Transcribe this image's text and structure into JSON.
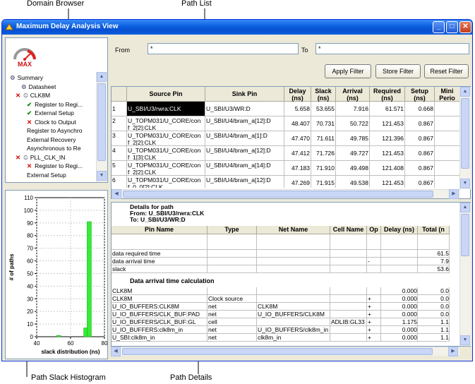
{
  "callouts": {
    "domain_browser": "Domain Browser",
    "path_list": "Path List",
    "path_slack_histogram": "Path Slack Histogram",
    "path_details": "Path Details"
  },
  "window": {
    "title": "Maximum Delay Analysis View",
    "minimize": "_",
    "maximize": "□",
    "close": "✕"
  },
  "logo": {
    "text": "MAX"
  },
  "filter": {
    "from_label": "From",
    "from_value": "*",
    "to_label": "To",
    "to_value": "*",
    "apply": "Apply Filter",
    "store": "Store Filter",
    "reset": "Reset Filter"
  },
  "tree": [
    {
      "label": "Summary",
      "icon": "summary-icon"
    },
    {
      "label": "Datasheet",
      "icon": "datasheet-icon"
    },
    {
      "label": "CLK8M",
      "icon": "clock-icon",
      "status": "✕"
    },
    {
      "label": "Register to Regi...",
      "status": "✔"
    },
    {
      "label": "External Setup",
      "status": "✔"
    },
    {
      "label": "Clock to Output",
      "status": "✕"
    },
    {
      "label": "Register to Asynchro"
    },
    {
      "label": "External Recovery"
    },
    {
      "label": "Asynchronous to Re"
    },
    {
      "label": "PLL_CLK_IN",
      "icon": "clock-icon",
      "status": "✕"
    },
    {
      "label": "Register to Regi...",
      "status": "✕"
    },
    {
      "label": "External Setup"
    }
  ],
  "chart_data": {
    "type": "bar",
    "xlabel": "slack distribution (ns)",
    "ylabel": "# of paths",
    "xlim": [
      40,
      80
    ],
    "ylim": [
      0,
      110
    ],
    "xticks": [
      40,
      60,
      80
    ],
    "yticks": [
      0,
      10,
      20,
      30,
      40,
      50,
      60,
      70,
      80,
      90,
      100,
      110
    ],
    "x": [
      53,
      69,
      71
    ],
    "values": [
      1,
      7,
      91
    ],
    "color": "#33ee33",
    "grid": true
  },
  "path_list": {
    "columns": [
      "",
      "Source Pin",
      "Sink Pin",
      "Delay\n(ns)",
      "Slack\n(ns)",
      "Arrival\n(ns)",
      "Required\n(ns)",
      "Setup\n(ns)",
      "Mini\nPerio"
    ],
    "rows": [
      [
        "1",
        "U_SBI/U3/rwra:CLK",
        "U_SBI/U3/WR:D",
        "5.658",
        "53.655",
        "7.916",
        "61.571",
        "0.668"
      ],
      [
        "2",
        "U_TOPM031/U_CORE/con\nf_2[2]:CLK",
        "U_SBI/U4/bram_a[12]:D",
        "48.407",
        "70.731",
        "50.722",
        "121.453",
        "0.867"
      ],
      [
        "3",
        "U_TOPM031/U_CORE/con\nf_2[2]:CLK",
        "U_SBI/U4/bram_a[1]:D",
        "47.470",
        "71.611",
        "49.785",
        "121.396",
        "0.867"
      ],
      [
        "4",
        "U_TOPM031/U_CORE/con\nf_1[3]:CLK",
        "U_SBI/U4/bram_a[12]:D",
        "47.412",
        "71.726",
        "49.727",
        "121.453",
        "0.867"
      ],
      [
        "5",
        "U_TOPM031/U_CORE/con\nf_2[2]:CLK",
        "U_SBI/U4/bram_a[14]:D",
        "47.183",
        "71.910",
        "49.498",
        "121.408",
        "0.867"
      ],
      [
        "6",
        "U_TOPM031/U_CORE/con\nf_0_0[2]:CLK",
        "U_SBI/U4/bram_a[12]:D",
        "47.269",
        "71.915",
        "49.538",
        "121.453",
        "0.867"
      ]
    ]
  },
  "details": {
    "line1": "Details for path",
    "line2": "From: U_SBI/U3/rwra:CLK",
    "line3": "To: U_SBI/U3/WR:D",
    "columns": [
      "Pin Name",
      "Type",
      "Net Name",
      "Cell Name",
      "Op",
      "Delay (ns)",
      "Total (n"
    ],
    "summary_rows": [
      [
        "data required time",
        "",
        "",
        "",
        "",
        "",
        "61.5"
      ],
      [
        "data arrival time",
        "",
        "",
        "",
        "-",
        "",
        "7.9"
      ],
      [
        "slack",
        "",
        "",
        "",
        "",
        "",
        "53.6"
      ]
    ],
    "section_title": "Data arrival time calculation",
    "calc_rows": [
      [
        "CLK8M",
        "",
        "",
        "",
        "",
        "0.000",
        "0.0"
      ],
      [
        "CLK8M",
        "Clock source",
        "",
        "",
        "+",
        "0.000",
        "0.0"
      ],
      [
        "U_IO_BUFFERS:CLK8M",
        "net",
        "CLK8M",
        "",
        "+",
        "0.000",
        "0.0"
      ],
      [
        "U_IO_BUFFERS/CLK_BUF:PAD",
        "net",
        "U_IO_BUFFERS/CLK8M",
        "",
        "+",
        "0.000",
        "0.0"
      ],
      [
        "U_IO_BUFFERS/CLK_BUF:GL",
        "cell",
        "",
        "ADLIB:GL33",
        "+",
        "1.175",
        "1.1"
      ],
      [
        "U_IO_BUFFERS:clk8m_in",
        "net",
        "U_IO_BUFFERS/clk8m_in",
        "",
        "+",
        "0.000",
        "1.1"
      ],
      [
        "U_SBI:clk8m_in",
        "net",
        "clk8m_in",
        "",
        "+",
        "0.000",
        "1.1"
      ]
    ]
  }
}
